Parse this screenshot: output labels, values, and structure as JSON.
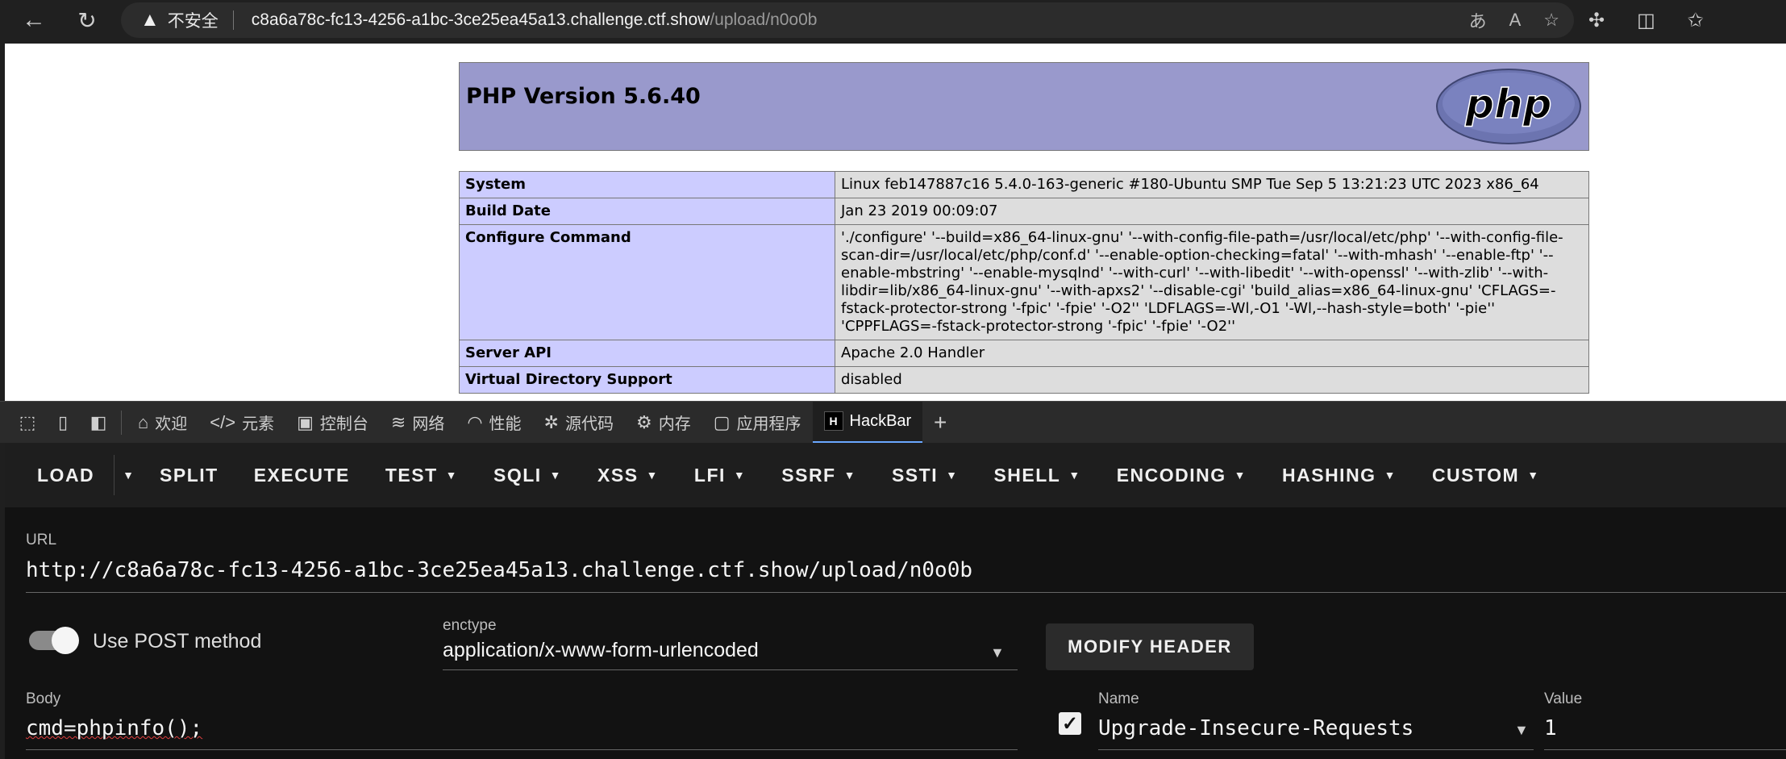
{
  "browser": {
    "insecure_label": "不安全",
    "url_host": "c8a6a78c-fc13-4256-a1bc-3ce25ea45a13.challenge.ctf.show",
    "url_path": "/upload/n0o0b"
  },
  "phpinfo": {
    "title": "PHP Version 5.6.40",
    "logo_text": "php",
    "rows": [
      {
        "label": "System",
        "value": "Linux feb147887c16 5.4.0-163-generic #180-Ubuntu SMP Tue Sep 5 13:21:23 UTC 2023 x86_64"
      },
      {
        "label": "Build Date",
        "value": "Jan 23 2019 00:09:07"
      },
      {
        "label": "Configure Command",
        "value": "'./configure' '--build=x86_64-linux-gnu' '--with-config-file-path=/usr/local/etc/php' '--with-config-file-scan-dir=/usr/local/etc/php/conf.d' '--enable-option-checking=fatal' '--with-mhash' '--enable-ftp' '--enable-mbstring' '--enable-mysqlnd' '--with-curl' '--with-libedit' '--with-openssl' '--with-zlib' '--with-libdir=lib/x86_64-linux-gnu' '--with-apxs2' '--disable-cgi' 'build_alias=x86_64-linux-gnu' 'CFLAGS=-fstack-protector-strong '-fpic' '-fpie' '-O2'' 'LDFLAGS=-Wl,-O1 '-Wl,--hash-style=both' '-pie'' 'CPPFLAGS=-fstack-protector-strong '-fpic' '-fpie' '-O2''"
      },
      {
        "label": "Server API",
        "value": "Apache 2.0 Handler"
      },
      {
        "label": "Virtual Directory Support",
        "value": "disabled"
      }
    ]
  },
  "devtools": {
    "tabs": [
      {
        "label": "欢迎",
        "icon": "home-icon"
      },
      {
        "label": "元素",
        "icon": "code-icon"
      },
      {
        "label": "控制台",
        "icon": "console-icon"
      },
      {
        "label": "网络",
        "icon": "wifi-icon"
      },
      {
        "label": "性能",
        "icon": "performance-icon"
      },
      {
        "label": "源代码",
        "icon": "bug-icon"
      },
      {
        "label": "内存",
        "icon": "memory-icon"
      },
      {
        "label": "应用程序",
        "icon": "application-icon"
      },
      {
        "label": "HackBar",
        "icon": "hackbar-icon"
      }
    ],
    "hackbar_badge": "H"
  },
  "hackbar": {
    "toolbar": [
      "LOAD",
      "SPLIT",
      "EXECUTE",
      "TEST",
      "SQLI",
      "XSS",
      "LFI",
      "SSRF",
      "SSTI",
      "SHELL",
      "ENCODING",
      "HASHING",
      "CUSTOM"
    ],
    "url_label": "URL",
    "url_value": "http://c8a6a78c-fc13-4256-a1bc-3ce25ea45a13.challenge.ctf.show/upload/n0o0b",
    "post_label": "Use POST method",
    "post_enabled": true,
    "enctype_label": "enctype",
    "enctype_value": "application/x-www-form-urlencoded",
    "modify_header_label": "MODIFY HEADER",
    "body_label": "Body",
    "body_value": "cmd=phpinfo();",
    "header_name_label": "Name",
    "header_name_value": "Upgrade-Insecure-Requests",
    "header_value_label": "Value",
    "header_value_value": "1",
    "header_checked": true
  }
}
